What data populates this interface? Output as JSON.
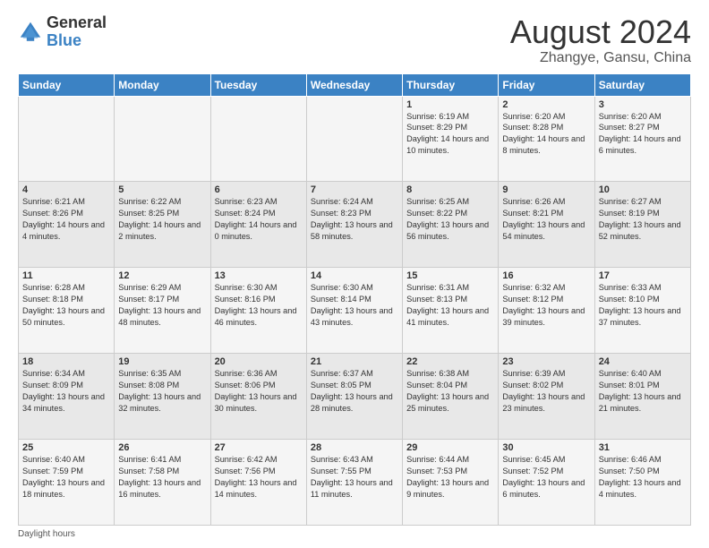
{
  "logo": {
    "general": "General",
    "blue": "Blue"
  },
  "title": "August 2024",
  "subtitle": "Zhangye, Gansu, China",
  "days_header": [
    "Sunday",
    "Monday",
    "Tuesday",
    "Wednesday",
    "Thursday",
    "Friday",
    "Saturday"
  ],
  "footer": "Daylight hours",
  "weeks": [
    [
      {
        "day": "",
        "sunrise": "",
        "sunset": "",
        "daylight": ""
      },
      {
        "day": "",
        "sunrise": "",
        "sunset": "",
        "daylight": ""
      },
      {
        "day": "",
        "sunrise": "",
        "sunset": "",
        "daylight": ""
      },
      {
        "day": "",
        "sunrise": "",
        "sunset": "",
        "daylight": ""
      },
      {
        "day": "1",
        "sunrise": "Sunrise: 6:19 AM",
        "sunset": "Sunset: 8:29 PM",
        "daylight": "Daylight: 14 hours and 10 minutes."
      },
      {
        "day": "2",
        "sunrise": "Sunrise: 6:20 AM",
        "sunset": "Sunset: 8:28 PM",
        "daylight": "Daylight: 14 hours and 8 minutes."
      },
      {
        "day": "3",
        "sunrise": "Sunrise: 6:20 AM",
        "sunset": "Sunset: 8:27 PM",
        "daylight": "Daylight: 14 hours and 6 minutes."
      }
    ],
    [
      {
        "day": "4",
        "sunrise": "Sunrise: 6:21 AM",
        "sunset": "Sunset: 8:26 PM",
        "daylight": "Daylight: 14 hours and 4 minutes."
      },
      {
        "day": "5",
        "sunrise": "Sunrise: 6:22 AM",
        "sunset": "Sunset: 8:25 PM",
        "daylight": "Daylight: 14 hours and 2 minutes."
      },
      {
        "day": "6",
        "sunrise": "Sunrise: 6:23 AM",
        "sunset": "Sunset: 8:24 PM",
        "daylight": "Daylight: 14 hours and 0 minutes."
      },
      {
        "day": "7",
        "sunrise": "Sunrise: 6:24 AM",
        "sunset": "Sunset: 8:23 PM",
        "daylight": "Daylight: 13 hours and 58 minutes."
      },
      {
        "day": "8",
        "sunrise": "Sunrise: 6:25 AM",
        "sunset": "Sunset: 8:22 PM",
        "daylight": "Daylight: 13 hours and 56 minutes."
      },
      {
        "day": "9",
        "sunrise": "Sunrise: 6:26 AM",
        "sunset": "Sunset: 8:21 PM",
        "daylight": "Daylight: 13 hours and 54 minutes."
      },
      {
        "day": "10",
        "sunrise": "Sunrise: 6:27 AM",
        "sunset": "Sunset: 8:19 PM",
        "daylight": "Daylight: 13 hours and 52 minutes."
      }
    ],
    [
      {
        "day": "11",
        "sunrise": "Sunrise: 6:28 AM",
        "sunset": "Sunset: 8:18 PM",
        "daylight": "Daylight: 13 hours and 50 minutes."
      },
      {
        "day": "12",
        "sunrise": "Sunrise: 6:29 AM",
        "sunset": "Sunset: 8:17 PM",
        "daylight": "Daylight: 13 hours and 48 minutes."
      },
      {
        "day": "13",
        "sunrise": "Sunrise: 6:30 AM",
        "sunset": "Sunset: 8:16 PM",
        "daylight": "Daylight: 13 hours and 46 minutes."
      },
      {
        "day": "14",
        "sunrise": "Sunrise: 6:30 AM",
        "sunset": "Sunset: 8:14 PM",
        "daylight": "Daylight: 13 hours and 43 minutes."
      },
      {
        "day": "15",
        "sunrise": "Sunrise: 6:31 AM",
        "sunset": "Sunset: 8:13 PM",
        "daylight": "Daylight: 13 hours and 41 minutes."
      },
      {
        "day": "16",
        "sunrise": "Sunrise: 6:32 AM",
        "sunset": "Sunset: 8:12 PM",
        "daylight": "Daylight: 13 hours and 39 minutes."
      },
      {
        "day": "17",
        "sunrise": "Sunrise: 6:33 AM",
        "sunset": "Sunset: 8:10 PM",
        "daylight": "Daylight: 13 hours and 37 minutes."
      }
    ],
    [
      {
        "day": "18",
        "sunrise": "Sunrise: 6:34 AM",
        "sunset": "Sunset: 8:09 PM",
        "daylight": "Daylight: 13 hours and 34 minutes."
      },
      {
        "day": "19",
        "sunrise": "Sunrise: 6:35 AM",
        "sunset": "Sunset: 8:08 PM",
        "daylight": "Daylight: 13 hours and 32 minutes."
      },
      {
        "day": "20",
        "sunrise": "Sunrise: 6:36 AM",
        "sunset": "Sunset: 8:06 PM",
        "daylight": "Daylight: 13 hours and 30 minutes."
      },
      {
        "day": "21",
        "sunrise": "Sunrise: 6:37 AM",
        "sunset": "Sunset: 8:05 PM",
        "daylight": "Daylight: 13 hours and 28 minutes."
      },
      {
        "day": "22",
        "sunrise": "Sunrise: 6:38 AM",
        "sunset": "Sunset: 8:04 PM",
        "daylight": "Daylight: 13 hours and 25 minutes."
      },
      {
        "day": "23",
        "sunrise": "Sunrise: 6:39 AM",
        "sunset": "Sunset: 8:02 PM",
        "daylight": "Daylight: 13 hours and 23 minutes."
      },
      {
        "day": "24",
        "sunrise": "Sunrise: 6:40 AM",
        "sunset": "Sunset: 8:01 PM",
        "daylight": "Daylight: 13 hours and 21 minutes."
      }
    ],
    [
      {
        "day": "25",
        "sunrise": "Sunrise: 6:40 AM",
        "sunset": "Sunset: 7:59 PM",
        "daylight": "Daylight: 13 hours and 18 minutes."
      },
      {
        "day": "26",
        "sunrise": "Sunrise: 6:41 AM",
        "sunset": "Sunset: 7:58 PM",
        "daylight": "Daylight: 13 hours and 16 minutes."
      },
      {
        "day": "27",
        "sunrise": "Sunrise: 6:42 AM",
        "sunset": "Sunset: 7:56 PM",
        "daylight": "Daylight: 13 hours and 14 minutes."
      },
      {
        "day": "28",
        "sunrise": "Sunrise: 6:43 AM",
        "sunset": "Sunset: 7:55 PM",
        "daylight": "Daylight: 13 hours and 11 minutes."
      },
      {
        "day": "29",
        "sunrise": "Sunrise: 6:44 AM",
        "sunset": "Sunset: 7:53 PM",
        "daylight": "Daylight: 13 hours and 9 minutes."
      },
      {
        "day": "30",
        "sunrise": "Sunrise: 6:45 AM",
        "sunset": "Sunset: 7:52 PM",
        "daylight": "Daylight: 13 hours and 6 minutes."
      },
      {
        "day": "31",
        "sunrise": "Sunrise: 6:46 AM",
        "sunset": "Sunset: 7:50 PM",
        "daylight": "Daylight: 13 hours and 4 minutes."
      }
    ]
  ]
}
